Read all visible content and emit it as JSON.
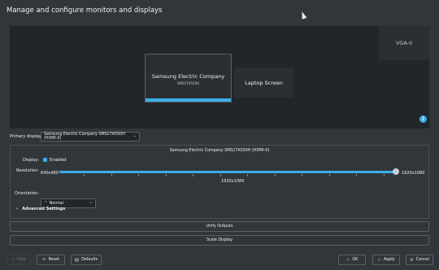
{
  "window": {
    "title": "Manage and configure monitors and displays"
  },
  "layout_view": {
    "monitors": [
      {
        "name": "Samsung Electric Company",
        "model": "SMS27A550H"
      },
      {
        "name": "Laptop Screen"
      },
      {
        "name": "VGA-0"
      }
    ]
  },
  "primary_display": {
    "label": "Primary display:",
    "value": "Samsung Electric Company SMS27A550H (HDMI-0)"
  },
  "settings": {
    "output_name": "Samsung Electric Company SMS27A550H (HDMI-0)",
    "display_label": "Display:",
    "enabled_label": "Enabled",
    "enabled": true,
    "resolution_label": "Resolution:",
    "res_min": "640x480",
    "res_max": "1920x1080",
    "res_current": "1920x1080",
    "res_fraction": 1.0,
    "orientation_label": "Orientation:",
    "orientation_value": "Normal",
    "advanced_label": "Advanced Settings"
  },
  "actions": {
    "unify": "Unify Outputs",
    "scale": "Scale Display"
  },
  "footer": {
    "help": "Help",
    "reset": "Reset",
    "defaults": "Defaults",
    "ok": "OK",
    "apply": "Apply",
    "cancel": "Cancel"
  },
  "colors": {
    "accent": "#3daee9",
    "background": "#31363b",
    "canvas": "#232629"
  }
}
